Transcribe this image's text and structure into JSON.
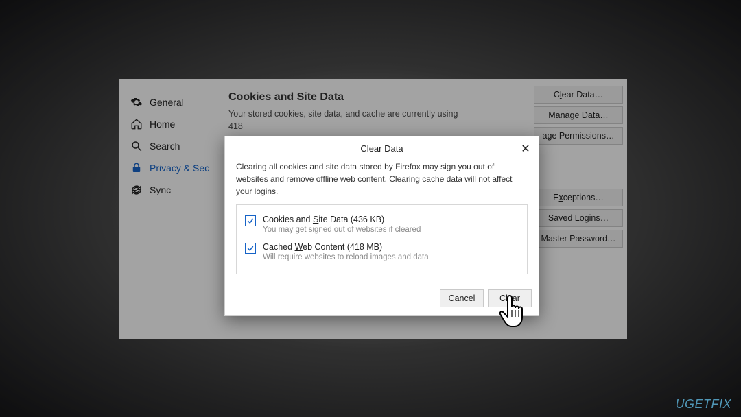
{
  "sidebar": {
    "items": [
      {
        "label": "General"
      },
      {
        "label": "Home"
      },
      {
        "label": "Search"
      },
      {
        "label": "Privacy & Sec"
      },
      {
        "label": "Sync"
      }
    ]
  },
  "content": {
    "section_title": "Cookies and Site Data",
    "section_desc": "Your stored cookies, site data, and cache are currently using 418",
    "buttons": {
      "clear_data": "Clear Data…",
      "manage_data": "Manage Data…",
      "permissions": "age Permissions…",
      "exceptions": "Exceptions…",
      "saved_logins": "Saved Logins…",
      "master_password": "Master Password…"
    }
  },
  "dialog": {
    "title": "Clear Data",
    "close": "✕",
    "desc": "Clearing all cookies and site data stored by Firefox may sign you out of websites and remove offline web content. Clearing cache data will not affect your logins.",
    "opts": [
      {
        "label_pre": "Cookies and ",
        "label_u": "S",
        "label_post": "ite Data (436 KB)",
        "sub": "You may get signed out of websites if cleared",
        "checked": true
      },
      {
        "label_pre": "Cached ",
        "label_u": "W",
        "label_post": "eb Content (418 MB)",
        "sub": "Will require websites to reload images and data",
        "checked": true
      }
    ],
    "cancel": "Cancel",
    "clear": "Clear"
  },
  "watermark": "UGETFIX"
}
